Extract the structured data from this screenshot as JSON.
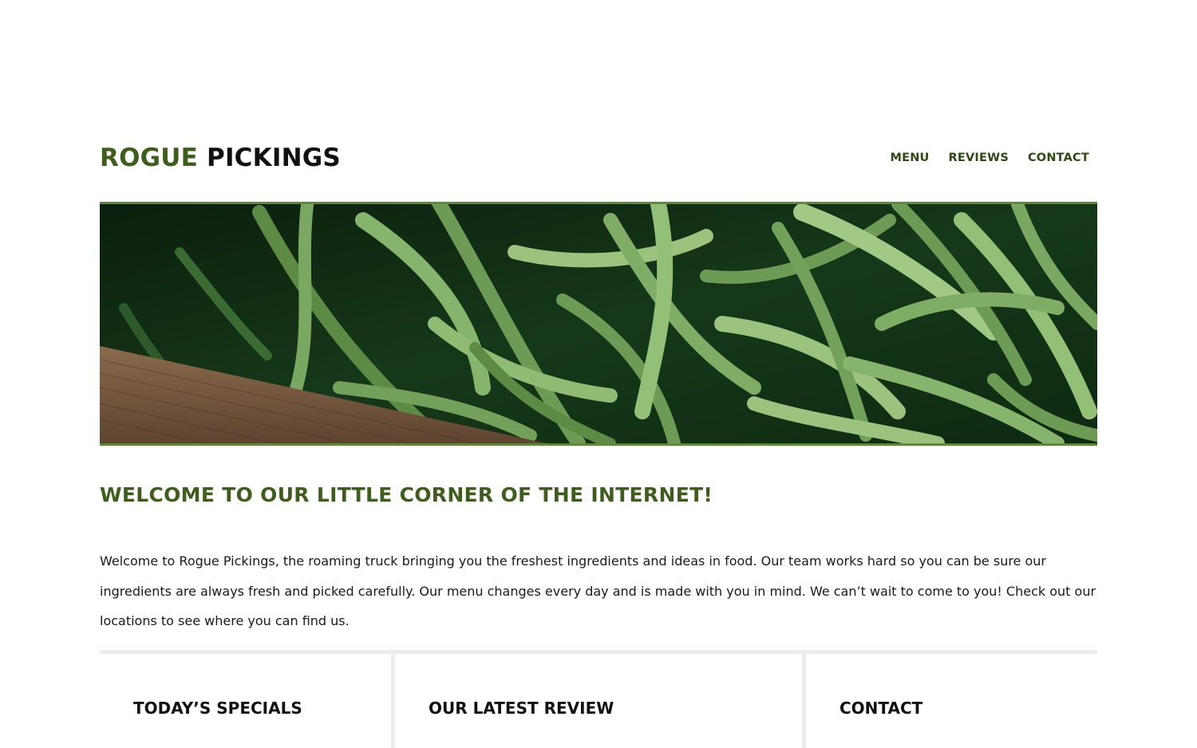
{
  "brand": {
    "accent": "ROGUE",
    "rest": " PICKINGS",
    "accent_color": "#3e5f1b"
  },
  "nav": {
    "items": [
      {
        "label": "MENU"
      },
      {
        "label": "REVIEWS"
      },
      {
        "label": "CONTACT"
      }
    ]
  },
  "hero": {
    "image_subject": "green beans in a wooden crate"
  },
  "welcome": {
    "title": "WELCOME TO OUR LITTLE CORNER OF THE INTERNET!",
    "body": "Welcome to Rogue Pickings, the roaming truck bringing you the freshest ingredients and ideas in food. Our team works hard so you can be sure our ingredients are always fresh and picked carefully. Our menu changes every day and is made with you in mind. We can’t wait to come to you! Check out our locations to see where you can find us."
  },
  "sections": [
    {
      "title": "TODAY’S SPECIALS"
    },
    {
      "title": "OUR LATEST REVIEW"
    },
    {
      "title": "CONTACT"
    }
  ]
}
